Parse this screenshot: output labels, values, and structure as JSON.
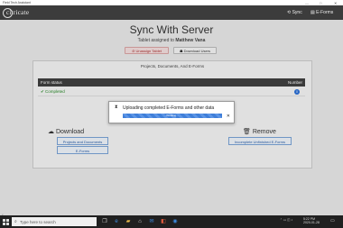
{
  "window": {
    "title": "Field Tech Assistant",
    "controls": [
      "—",
      "□",
      "✕"
    ]
  },
  "appbar": {
    "logo": "citricate",
    "sync_label": "Sync",
    "eforms_label": "E-Forms"
  },
  "page": {
    "title": "Sync With Server",
    "subtitle_prefix": "Tablet assigned to",
    "assignee": "Matthew Vana",
    "unassign_label": "Unassign Tablet",
    "download_users_label": "Download Users"
  },
  "panel": {
    "title": "Projects, Documents, And E-Forms",
    "table_headers": [
      "Form status",
      "Number"
    ],
    "rows": [
      {
        "status": "Completed",
        "number": "0"
      }
    ],
    "download": {
      "title": "Download",
      "buttons": [
        "Projects and Documents",
        "E-Forms"
      ]
    },
    "remove": {
      "title": "Remove",
      "buttons": [
        "Incomplete Unfinished E-Forms"
      ]
    }
  },
  "dialog": {
    "message": "Uploading completed E-Forms and other data",
    "progress_label": "Working...",
    "progress": 1.0
  },
  "taskbar": {
    "search_placeholder": "Type here to search",
    "time": "5:22 PM",
    "date": "2020-01-28"
  },
  "colors": {
    "appbar": "#3c3c3c",
    "accent": "#2b6fd6",
    "success": "#2a8a2a",
    "danger": "#a33333"
  }
}
